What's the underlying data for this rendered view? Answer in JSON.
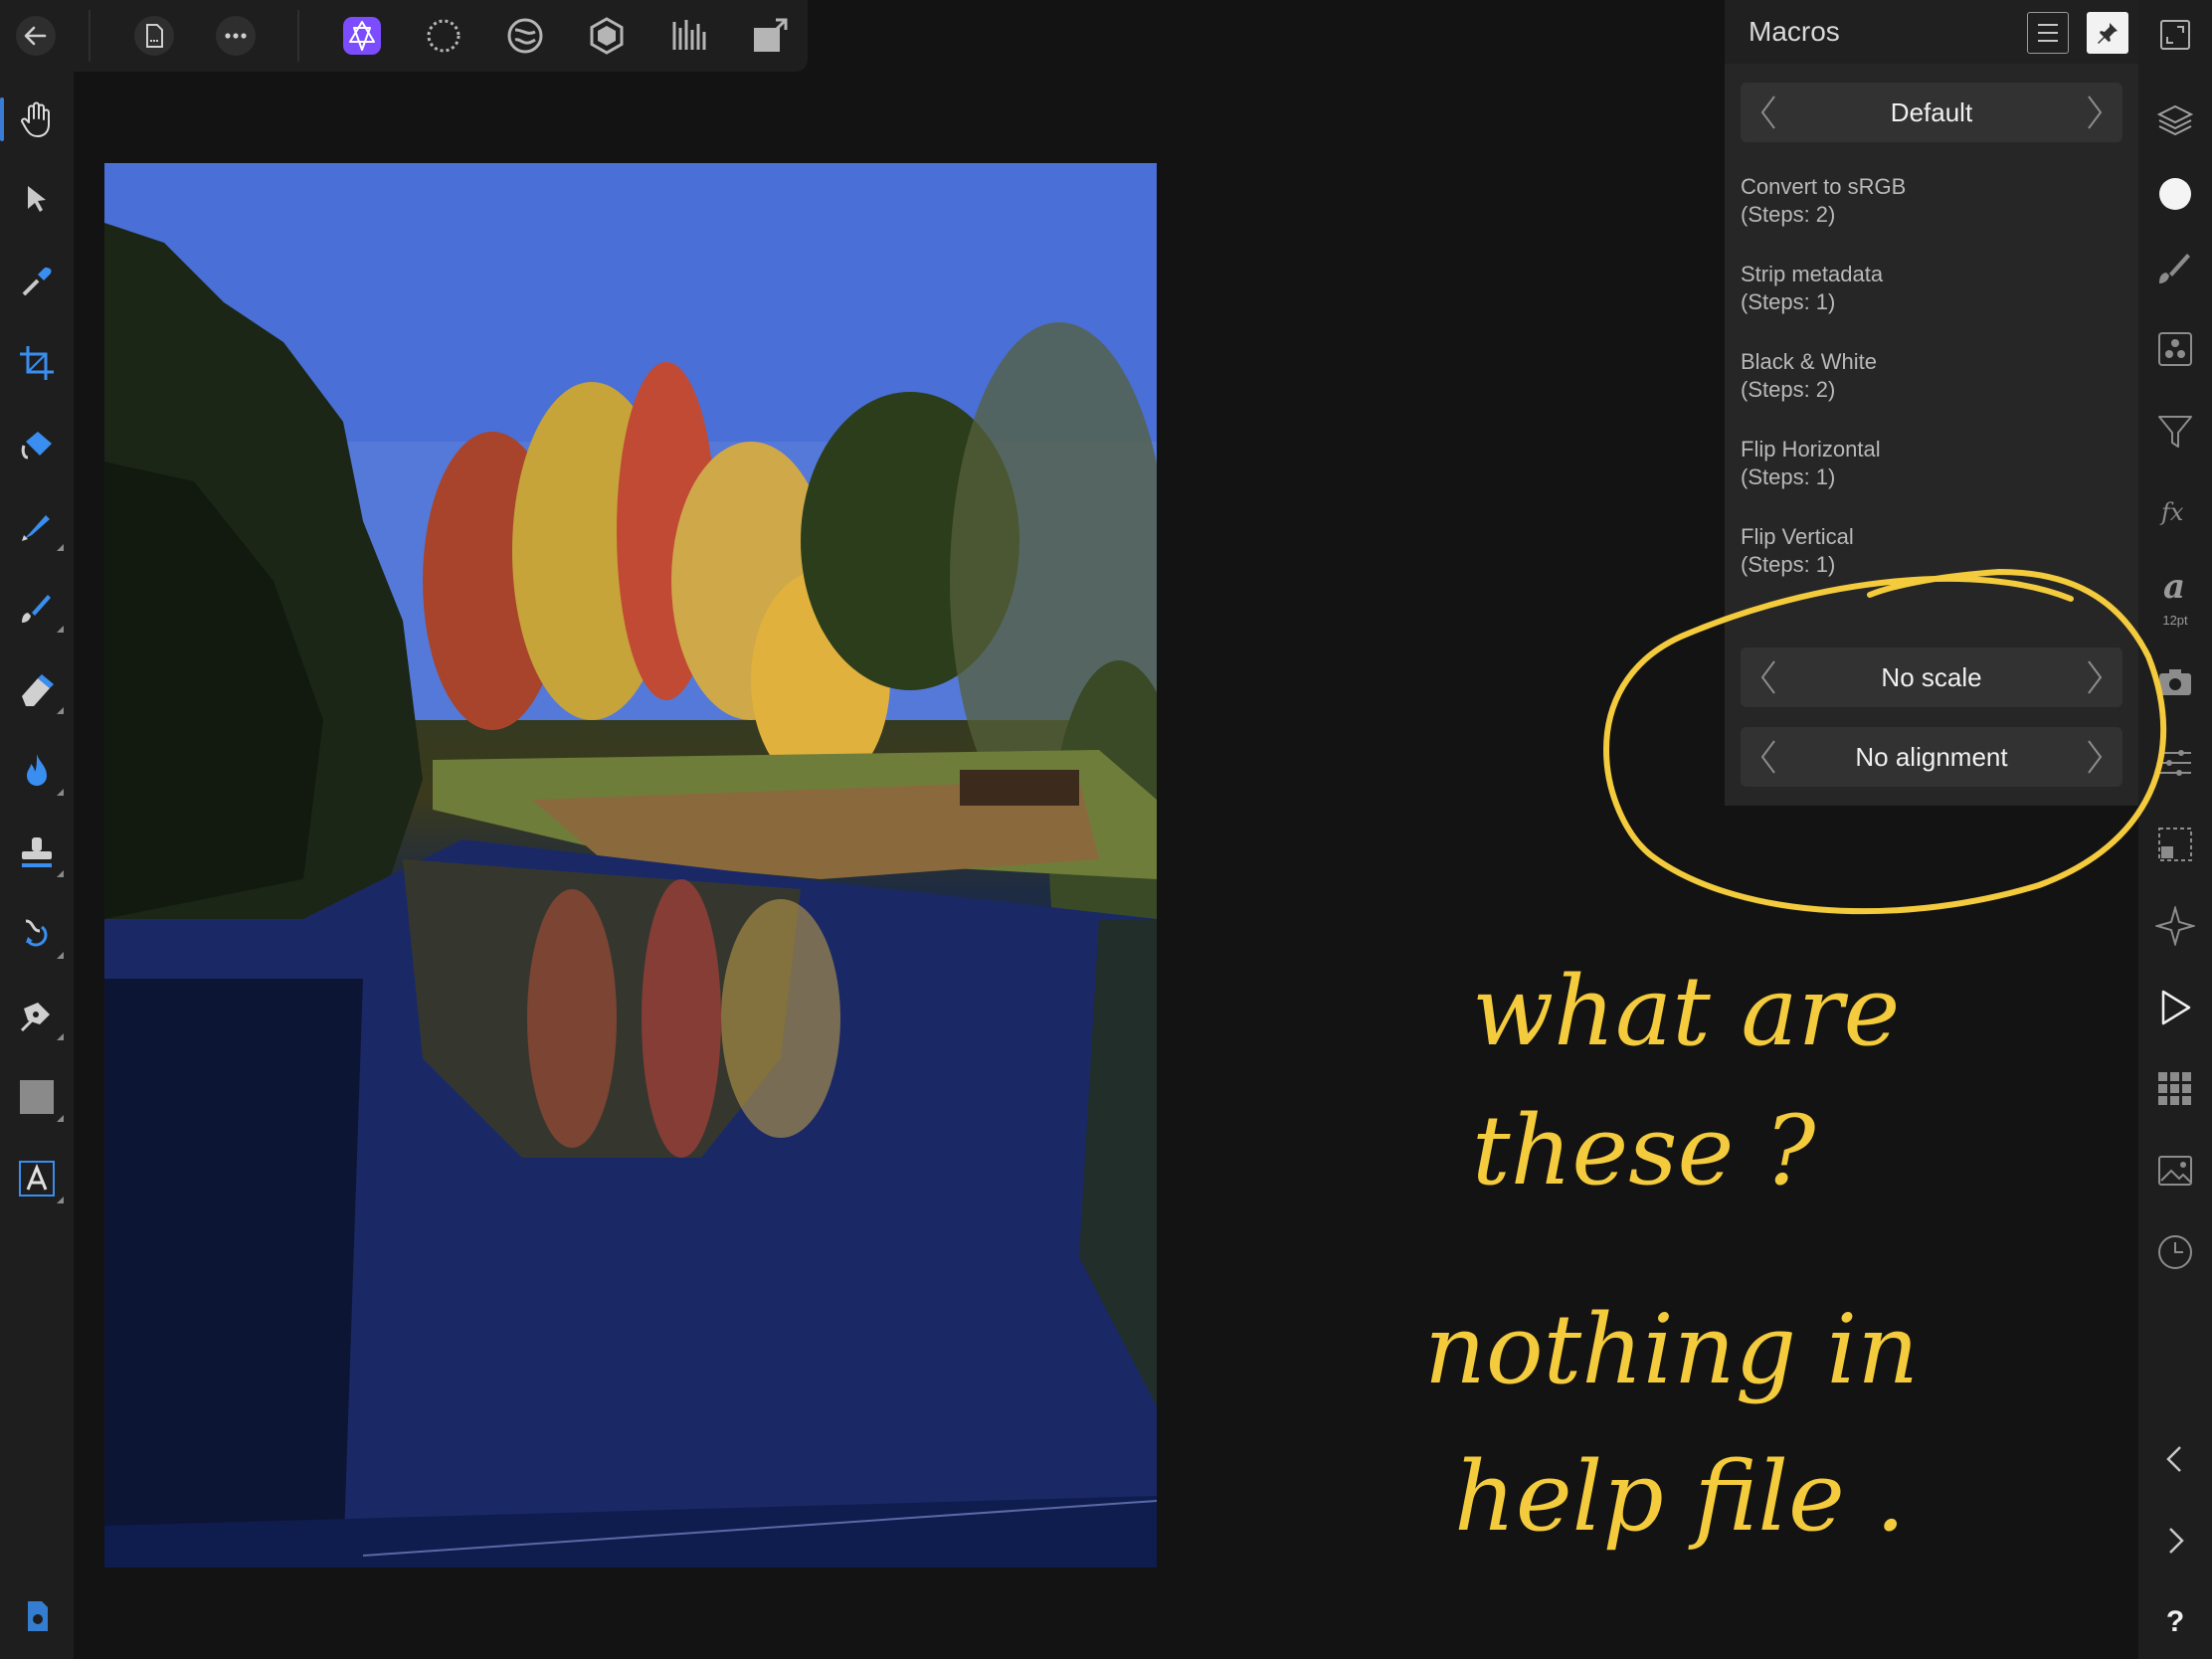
{
  "toolbar": {
    "buttons": [
      {
        "name": "back-button",
        "icon": "back-arrow-icon"
      },
      {
        "name": "document-button",
        "icon": "document-icon"
      },
      {
        "name": "more-button",
        "icon": "more-icon"
      },
      {
        "name": "photo-persona-button",
        "icon": "photo-persona-icon",
        "active": true
      },
      {
        "name": "selection-persona-button",
        "icon": "selection-persona-icon"
      },
      {
        "name": "liquify-persona-button",
        "icon": "liquify-persona-icon"
      },
      {
        "name": "develop-persona-button",
        "icon": "develop-persona-icon"
      },
      {
        "name": "tone-mapping-persona-button",
        "icon": "tone-mapping-persona-icon"
      },
      {
        "name": "export-persona-button",
        "icon": "export-persona-icon"
      }
    ],
    "accent": "#7b4dff"
  },
  "left_tools": [
    "hand-tool",
    "move-tool",
    "color-picker-tool",
    "crop-tool",
    "flood-fill-tool",
    "selection-brush-tool",
    "paint-brush-tool",
    "erase-brush-tool",
    "burn-tool",
    "clone-tool",
    "healing-tool",
    "pen-tool",
    "rectangle-tool",
    "artistic-text-tool"
  ],
  "macros_panel": {
    "title": "Macros",
    "library": "Default",
    "items": [
      {
        "name": "Convert to sRGB",
        "steps": "(Steps: 2)"
      },
      {
        "name": "Strip metadata",
        "steps": "(Steps: 1)"
      },
      {
        "name": "Black & White",
        "steps": "(Steps: 2)"
      },
      {
        "name": "Flip Horizontal",
        "steps": "(Steps: 1)"
      },
      {
        "name": "Flip Vertical",
        "steps": "(Steps: 1)"
      }
    ],
    "scale_option": "No scale",
    "alignment_option": "No alignment"
  },
  "right_studio": {
    "font_size_label": "12pt",
    "help_label": "?"
  },
  "annotation": {
    "color": "#f3cb3c",
    "lines": [
      "what are",
      "these ?",
      "nothing in",
      "help file ."
    ]
  }
}
